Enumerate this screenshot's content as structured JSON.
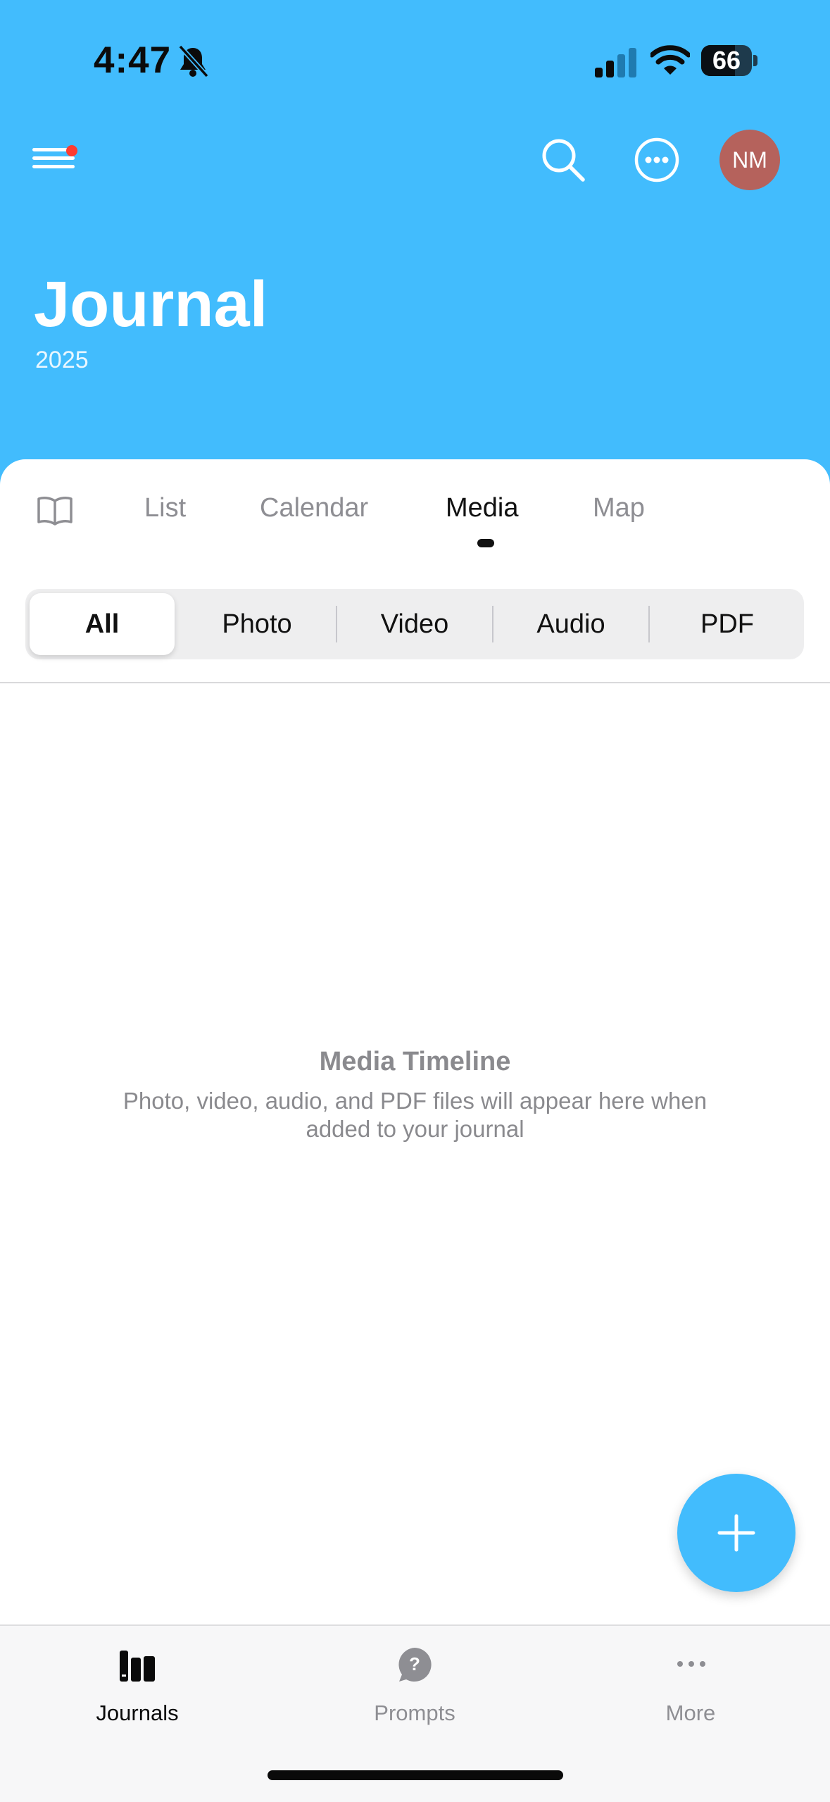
{
  "status_bar": {
    "time": "4:47",
    "battery": "66",
    "battery_level": 0.66
  },
  "header": {
    "title": "Journal",
    "subtitle": "2025",
    "avatar_initials": "NM"
  },
  "view_tabs": [
    "List",
    "Calendar",
    "Media",
    "Map"
  ],
  "active_view_tab": "Media",
  "filter_segments": [
    "All",
    "Photo",
    "Video",
    "Audio",
    "PDF"
  ],
  "active_filter": "All",
  "empty_state": {
    "title": "Media Timeline",
    "description": "Photo, video, audio, and PDF files will appear here when added to your journal"
  },
  "tab_bar": {
    "items": [
      "Journals",
      "Prompts",
      "More"
    ],
    "active": "Journals"
  },
  "colors": {
    "accent": "#42bcfd",
    "avatar": "#b5625c",
    "notification_dot": "#ff3b30"
  }
}
